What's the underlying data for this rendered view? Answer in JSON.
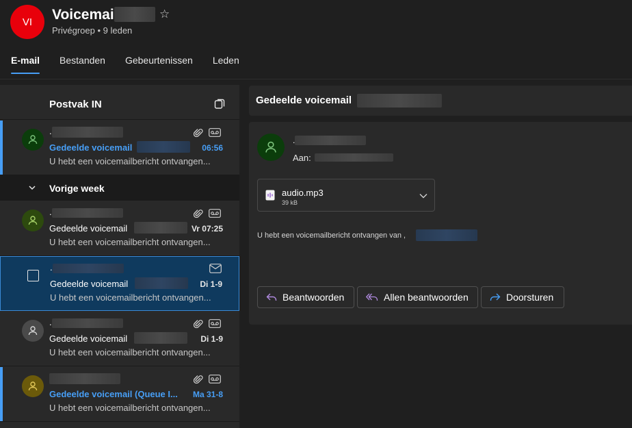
{
  "group": {
    "avatar_initials": "VI",
    "title": "Voicemail",
    "subtitle": "Privégroep • 9 leden"
  },
  "tabs": [
    {
      "label": "E-mail",
      "active": true
    },
    {
      "label": "Bestanden",
      "active": false
    },
    {
      "label": "Gebeurtenissen",
      "active": false
    },
    {
      "label": "Leden",
      "active": false
    }
  ],
  "list": {
    "title": "Postvak IN",
    "group_label": "Vorige week",
    "items": [
      {
        "sender": ".",
        "subject": "Gedeelde voicemail",
        "time": "06:56",
        "preview": "U hebt een voicemailbericht ontvangen...",
        "unread": true
      },
      {
        "sender": ".",
        "subject": "Gedeelde voicemail",
        "time": "Vr 07:25",
        "preview": "U hebt een voicemailbericht ontvangen..."
      },
      {
        "sender": ".",
        "subject": "Gedeelde voicemail",
        "time": "Di 1-9",
        "preview": "U hebt een voicemailbericht ontvangen..."
      },
      {
        "sender": ".",
        "subject": "Gedeelde voicemail",
        "time": "Di 1-9",
        "preview": "U hebt een voicemailbericht ontvangen..."
      },
      {
        "sender": "",
        "subject": "Gedeelde voicemail (Queue I...",
        "time": "Ma 31-8",
        "preview": "U hebt een voicemailbericht ontvangen...",
        "unread": true
      }
    ]
  },
  "reading": {
    "subject": "Gedeelde voicemail",
    "from": ".",
    "to_label": "Aan:",
    "attachment": {
      "name": "audio.mp3",
      "size": "39 kB"
    },
    "body": "U hebt een voicemailbericht ontvangen van ,",
    "buttons": {
      "reply": "Beantwoorden",
      "reply_all": "Allen beantwoorden",
      "forward": "Doorsturen"
    }
  },
  "colors": {
    "accent": "#479ef5",
    "group_avatar": "#e8000b",
    "selected_bg": "#0f3a5e"
  }
}
